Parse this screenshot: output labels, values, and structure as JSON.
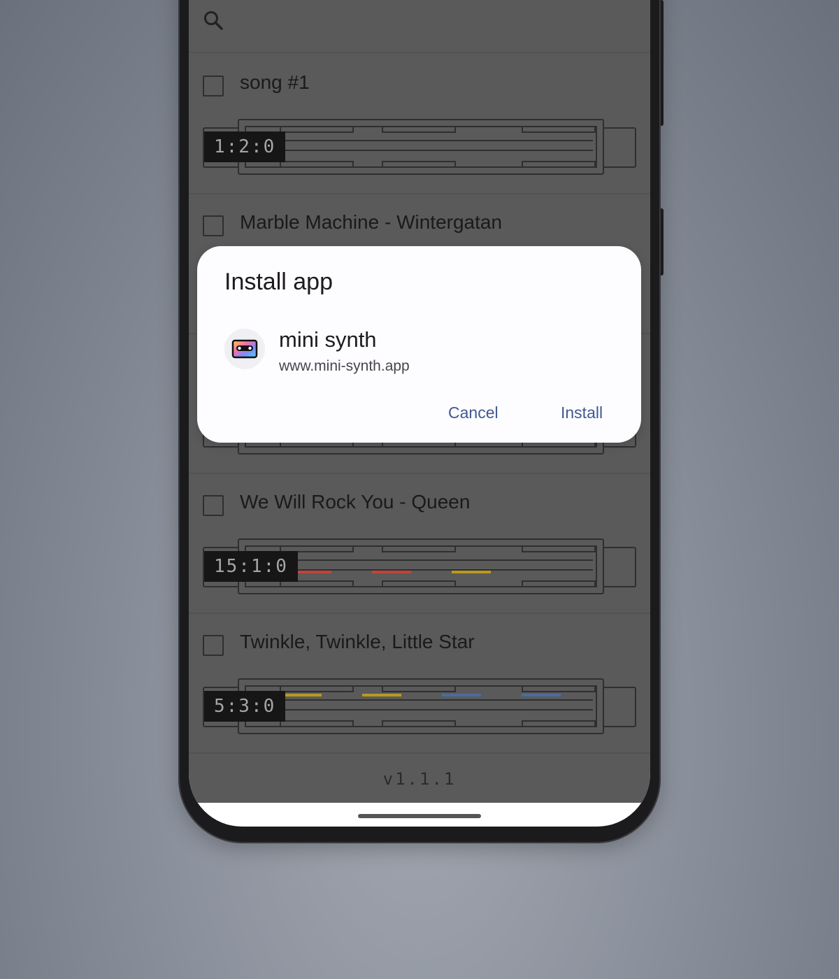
{
  "search": {
    "icon": "search-icon"
  },
  "songs": [
    {
      "title": "song #1",
      "counter": "1:2:0",
      "notes": []
    },
    {
      "title": "Marble Machine - Wintergatan",
      "counter": "",
      "notes": []
    },
    {
      "title": "",
      "counter": "",
      "notes": []
    },
    {
      "title": "We Will Rock You - Queen",
      "counter": "15:1:0",
      "notes": [
        "#c0453a",
        "#c0453a",
        "#b89a1e"
      ]
    },
    {
      "title": "Twinkle, Twinkle, Little Star",
      "counter": "5:3:0",
      "notes": [
        "#b89a1e",
        "#b89a1e",
        "#4c6c9c",
        "#4c6c9c"
      ]
    }
  ],
  "version": "v1.1.1",
  "dialog": {
    "title": "Install app",
    "app_name": "mini synth",
    "app_url": "www.mini-synth.app",
    "app_icon": "cassette-icon",
    "cancel_label": "Cancel",
    "install_label": "Install"
  },
  "colors": {
    "accent": "#3f5a8f",
    "app_background": "#5a5a5a",
    "dialog_background": "#fdfcff"
  }
}
